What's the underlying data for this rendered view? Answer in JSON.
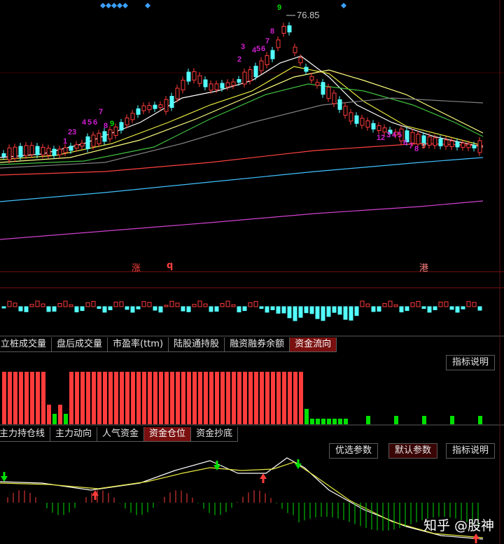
{
  "price_chart": {
    "last_price_label": "76.85",
    "td_labels": [
      "1",
      "23",
      "4",
      "5",
      "6",
      "7",
      "8",
      "9",
      "2",
      "3",
      "4",
      "5",
      "6",
      "7",
      "8",
      "9",
      "1",
      "2",
      "3",
      "4",
      "5",
      "6",
      "7",
      "8",
      "9"
    ],
    "markers": [
      "涨",
      "q",
      "港"
    ]
  },
  "tabs_row1": [
    {
      "label": "立桩成交量",
      "active": false
    },
    {
      "label": "盘后成交量",
      "active": false
    },
    {
      "label": "市盈率(ttm)",
      "active": false
    },
    {
      "label": "陆股通持股",
      "active": false
    },
    {
      "label": "融资融券余额",
      "active": false
    },
    {
      "label": "资金流向",
      "active": true
    }
  ],
  "tabs_row2": [
    {
      "label": "主力持仓线",
      "active": false
    },
    {
      "label": "主力动向",
      "active": false
    },
    {
      "label": "人气资金",
      "active": false
    },
    {
      "label": "资金仓位",
      "active": true
    },
    {
      "label": "资金抄底",
      "active": false
    }
  ],
  "panel1_buttons": {
    "help": "指标说明"
  },
  "panel2_buttons": {
    "optimize": "优选参数",
    "default": "默认参数",
    "help": "指标说明"
  },
  "colors": {
    "up": "#ff3b3b",
    "down": "#54ffff",
    "green": "#00e000",
    "active_tab": "#7a0f0f"
  },
  "watermark": "知乎 @股神"
}
